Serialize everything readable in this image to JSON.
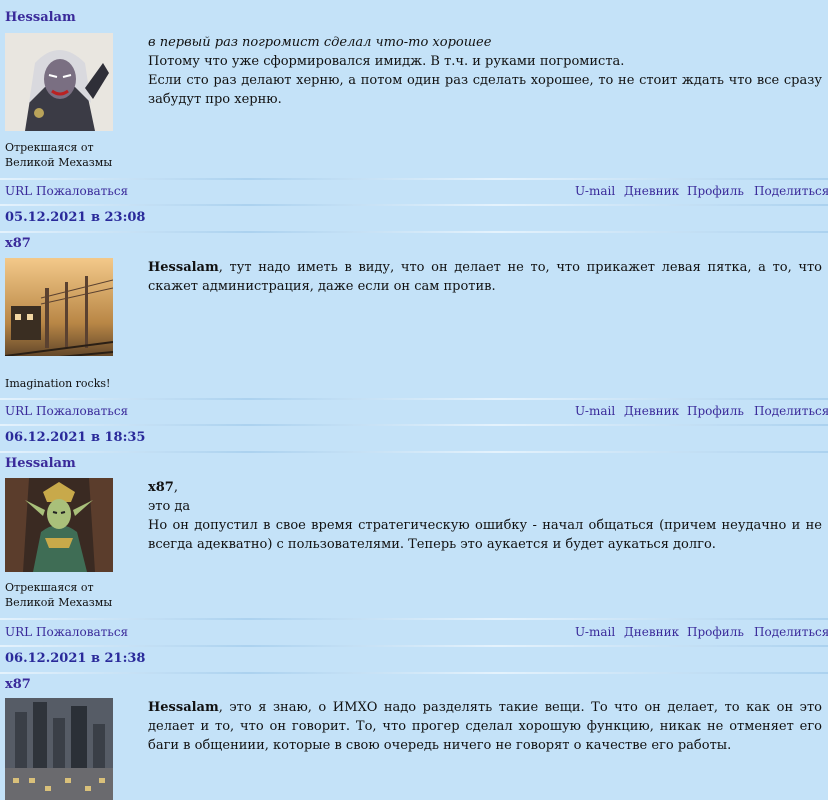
{
  "posts": [
    {
      "author": "Hessalam",
      "caption": "Отрекшаяся от Великой Мехазмы",
      "lines": [
        {
          "italic": "в первый раз погромист сделал что-то хорошее"
        },
        {
          "text": "Потому что уже сформировался имидж. В т.ч. и руками погромиста."
        },
        {
          "text": "Если сто раз делают херню, а потом один раз сделать хорошее, то не стоит ждать что все сразу забудут про херню."
        }
      ],
      "date": "05.12.2021 в 23:08"
    },
    {
      "author": "x87",
      "caption": "Imagination rocks!",
      "lines": [
        {
          "bold": "Hessalam",
          "text": ", тут надо иметь в виду, что он делает не то, что прикажет левая пятка, а то, что скажет администрация, даже если он сам против."
        }
      ],
      "date": "06.12.2021 в 18:35"
    },
    {
      "author": "Hessalam",
      "caption": "Отрекшаяся от Великой Мехазмы",
      "lines": [
        {
          "bold": "x87",
          "text": ","
        },
        {
          "text": "это да"
        },
        {
          "text": "Но он допустил в свое время стратегическую ошибку - начал общаться (причем неудачно и не всегда адекватно) с пользователями. Теперь это аукается и будет аукаться долго."
        }
      ],
      "date": "06.12.2021 в 21:38"
    },
    {
      "author": "x87",
      "caption": "",
      "lines": [
        {
          "bold": "Hessalam",
          "text": ", это я знаю, о ИМХО надо разделять такие вещи. То что он делает, то как он это делает и то, что он говорит. То, что прогер сделал хорошую функцию, никак не отменяет его баги в общениии, которые в свою очередь ничего не говорят о качестве его работы."
        }
      ]
    }
  ],
  "actions": {
    "url": "URL",
    "complain": "Пожаловаться",
    "umail": "U-mail",
    "diary": "Дневник",
    "profile": "Профиль",
    "share": "Поделиться"
  },
  "colors": {
    "background": "#c4e2f8",
    "link": "#3a2a9a",
    "date": "#2a2a9a"
  }
}
